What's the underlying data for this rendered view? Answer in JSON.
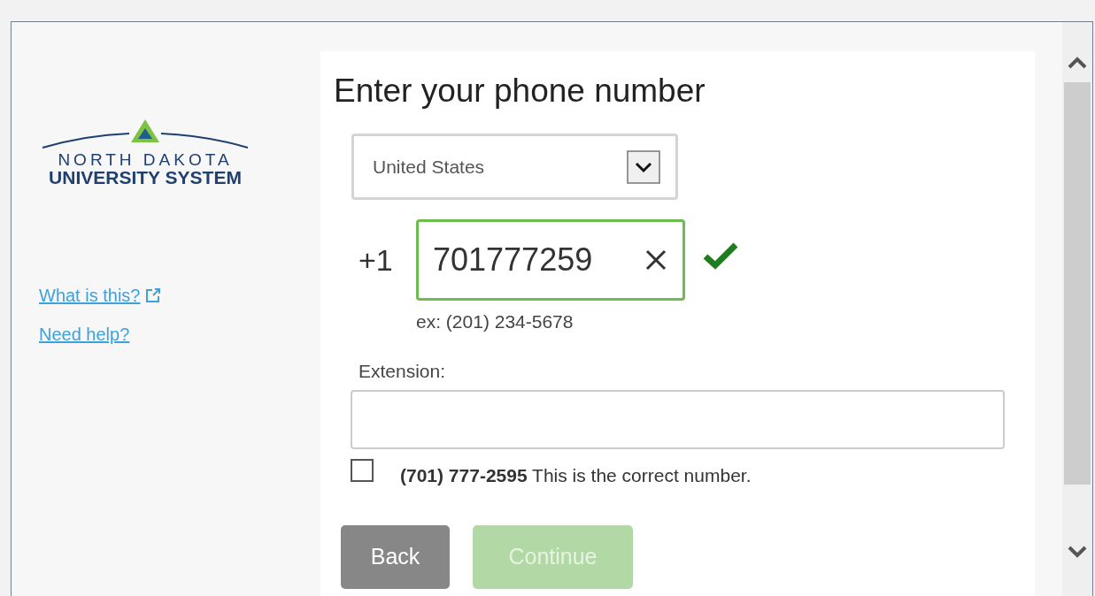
{
  "logo": {
    "line_1": "NORTH DAKOTA",
    "line_2": "UNIVERSITY SYSTEM"
  },
  "links": [
    {
      "label": "What is this?",
      "external": true
    },
    {
      "label": "Need help?",
      "external": false
    }
  ],
  "heading": "Enter your phone number",
  "country_select": {
    "value": "United States"
  },
  "phone": {
    "prefix": "+1",
    "value": "701777259",
    "valid": true,
    "example": "ex: (201) 234-5678"
  },
  "extension": {
    "label": "Extension:"
  },
  "confirm": {
    "checked": false,
    "text": "**(701) 777-2595** This is the correct number."
  },
  "buttons": [
    {
      "label": "Back",
      "disabled": false,
      "kind": "secondary"
    },
    {
      "label": "Continue",
      "disabled": true,
      "kind": "primary"
    }
  ]
}
